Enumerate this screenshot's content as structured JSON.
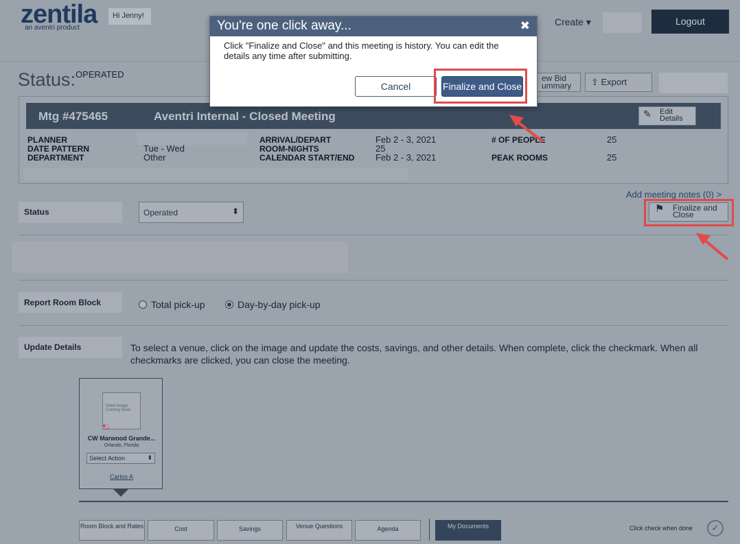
{
  "header": {
    "logo": "zentila",
    "logo_sub": "an aventri product",
    "greeting": "Hi Jenny!",
    "create_label": "Create ▾",
    "logout_label": "Logout"
  },
  "status": {
    "label": "Status:",
    "value": "OPERATED"
  },
  "toolbar": {
    "bid_summary_label": "ew Bid ummary",
    "export_label": "Export"
  },
  "meeting": {
    "number": "Mtg #475465",
    "name": "Aventri Internal - Closed Meeting",
    "edit_label": "Edit Details",
    "fields": {
      "planner_label": "PLANNER",
      "date_pattern_label": "DATE PATTERN",
      "date_pattern_value": "Tue - Wed",
      "department_label": "DEPARTMENT",
      "department_value": "Other",
      "arrival_label": "ARRIVAL/DEPART",
      "arrival_value": "Feb 2 - 3, 2021",
      "room_nights_label": "ROOM-NIGHTS",
      "room_nights_value": "25",
      "calendar_label": "CALENDAR START/END",
      "calendar_value": "Feb 2 - 3, 2021",
      "people_label": "# OF PEOPLE",
      "people_value": "25",
      "peak_label": "PEAK ROOMS",
      "peak_value": "25"
    }
  },
  "notes_link": "Add meeting notes (0) >",
  "finalize_page_label": "Finalize and Close",
  "status_row": {
    "label": "Status",
    "select_value": "Operated"
  },
  "room_block": {
    "label": "Report Room Block",
    "options": [
      "Total pick-up",
      "Day-by-day pick-up"
    ],
    "selected": 1
  },
  "update_details": {
    "label": "Update Details",
    "text": "To select a venue, click on the image and update the costs, savings, and other details. When complete, click the checkmark. When all checkmarks are clicked, you can close the meeting."
  },
  "venue": {
    "image_text": "Hotel Image Coming Soon",
    "name": "CW Marwood Grande...",
    "city": "Orlando, Florida",
    "select_value": "Select Action",
    "owner": "Carlos A"
  },
  "tabs": [
    {
      "label": "Room Block and Rates"
    },
    {
      "label": "Cost"
    },
    {
      "label": "Savings"
    },
    {
      "label": "Venue Questions"
    },
    {
      "label": "Agenda"
    },
    {
      "label": "My Documents"
    }
  ],
  "check_label": "Click check when done",
  "modal": {
    "title": "You're one click away...",
    "body": "Click \"Finalize and Close\" and this meeting is history. You can edit the details any time after submitting.",
    "cancel_label": "Cancel",
    "finalize_label": "Finalize and Close"
  },
  "colors": {
    "modal_header": "#4b617e",
    "primary_button": "#3e5a86",
    "highlight": "#e04b4b"
  }
}
